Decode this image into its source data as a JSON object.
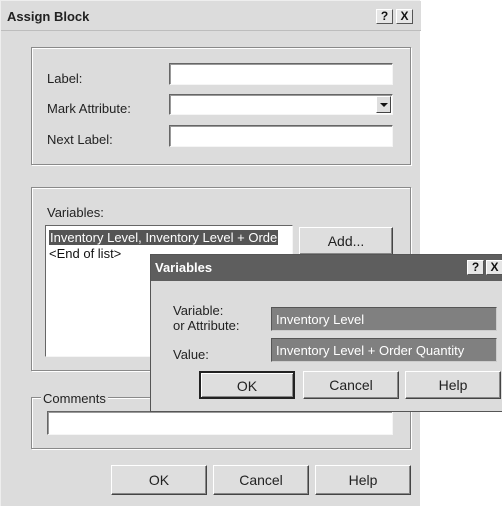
{
  "dialog": {
    "title": "Assign Block",
    "help_glyph": "?",
    "close_glyph": "X",
    "label_label": "Label:",
    "label_value": "",
    "mark_attribute_label": "Mark Attribute:",
    "mark_attribute_value": "",
    "next_label_label": "Next Label:",
    "next_label_value": "",
    "variables_label": "Variables:",
    "variables_items": [
      "Inventory Level, Inventory Level + Orde",
      "<End of list>"
    ],
    "add_button": "Add...",
    "comments_label": "Comments",
    "comments_value": "",
    "ok_button": "OK",
    "cancel_button": "Cancel",
    "help_button": "Help"
  },
  "popup": {
    "title": "Variables",
    "help_glyph": "?",
    "close_glyph": "X",
    "variable_label_line1": "Variable:",
    "variable_label_line2": "or Attribute:",
    "variable_value": "Inventory Level",
    "value_label": "Value:",
    "value_value": "Inventory Level + Order Quantity",
    "ok_button": "OK",
    "cancel_button": "Cancel",
    "help_button": "Help"
  }
}
